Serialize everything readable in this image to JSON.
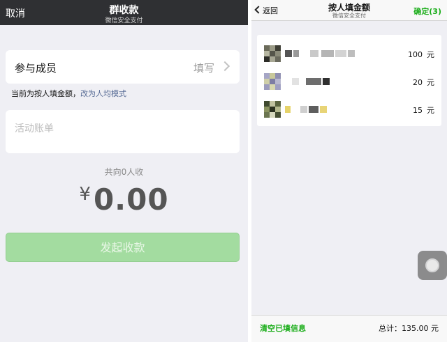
{
  "left": {
    "nav": {
      "cancel": "取消",
      "title": "群收款",
      "subtitle": "微信安全支付"
    },
    "members": {
      "label": "参与成员",
      "action": "填写"
    },
    "mode": {
      "current": "当前为按人填金额，",
      "switch": "改为人均模式"
    },
    "bill": {
      "placeholder": "活动账单"
    },
    "total_line": "共向0人收",
    "amount": {
      "symbol": "¥",
      "value": "0.00"
    },
    "start_button": "发起收款"
  },
  "right": {
    "nav": {
      "back": "返回",
      "title": "按人填金额",
      "subtitle": "微信安全支付",
      "confirm": "确定(3)"
    },
    "rows": [
      {
        "amount": "100",
        "unit": "元"
      },
      {
        "amount": "20",
        "unit": "元"
      },
      {
        "amount": "15",
        "unit": "元"
      }
    ],
    "footer": {
      "clear": "清空已填信息",
      "total": "总计：135.00 元"
    }
  },
  "colors": {
    "accent_green": "#1aad19",
    "disabled_button": "#a3dca0",
    "link_blue": "#576b95",
    "dark_nav": "#2f3033"
  }
}
